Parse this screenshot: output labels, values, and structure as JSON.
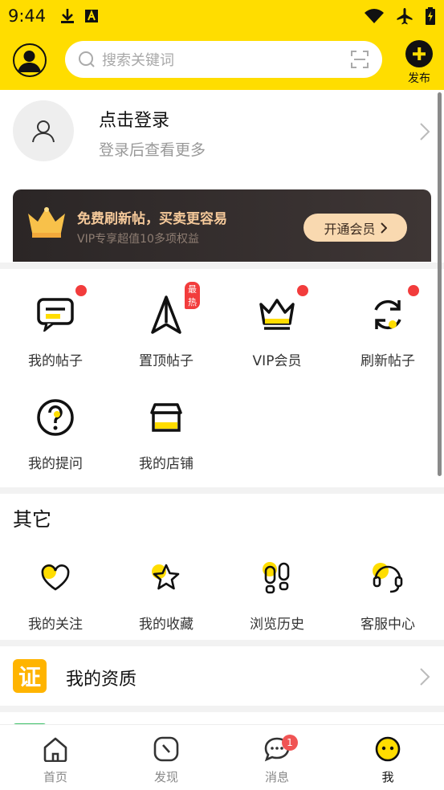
{
  "status": {
    "time": "9:44"
  },
  "search": {
    "placeholder": "搜索关键词"
  },
  "header": {
    "publish_label": "发布"
  },
  "profile": {
    "title": "点击登录",
    "subtitle": "登录后查看更多"
  },
  "vip_banner": {
    "headline": "免费刷新帖，买卖更容易",
    "sub": "VIP专享超值10多项权益",
    "button": "开通会员"
  },
  "services": [
    {
      "label": "我的帖子",
      "icon": "message-icon",
      "dot": true
    },
    {
      "label": "置顶帖子",
      "icon": "arrow-up-icon",
      "tag": "最热"
    },
    {
      "label": "VIP会员",
      "icon": "crown-icon",
      "dot": true
    },
    {
      "label": "刷新帖子",
      "icon": "refresh-icon",
      "dot": true
    },
    {
      "label": "我的提问",
      "icon": "question-icon"
    },
    {
      "label": "我的店铺",
      "icon": "shop-icon"
    }
  ],
  "other": {
    "title": "其它",
    "items": [
      {
        "label": "我的关注",
        "icon": "heart-icon"
      },
      {
        "label": "我的收藏",
        "icon": "star-icon"
      },
      {
        "label": "浏览历史",
        "icon": "footprint-icon"
      },
      {
        "label": "客服中心",
        "icon": "headset-icon"
      }
    ]
  },
  "qualification": {
    "badge": "证",
    "label": "我的资质"
  },
  "tabbar": [
    {
      "label": "首页",
      "icon": "home-icon"
    },
    {
      "label": "发现",
      "icon": "compass-icon"
    },
    {
      "label": "消息",
      "icon": "chat-icon",
      "badge": "1"
    },
    {
      "label": "我",
      "icon": "face-icon",
      "active": true
    }
  ],
  "colors": {
    "brand_yellow": "#ffdd00",
    "red_dot": "#f23c3c",
    "vip_gold": "#f5c99a"
  }
}
